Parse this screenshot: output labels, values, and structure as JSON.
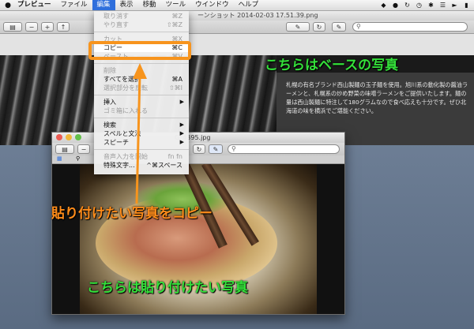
{
  "menubar": {
    "apple": "",
    "items": [
      {
        "label": "プレビュー",
        "bold": true
      },
      {
        "label": "ファイル",
        "bold": false
      },
      {
        "label": "編集",
        "bold": false
      },
      {
        "label": "表示",
        "bold": false
      },
      {
        "label": "移動",
        "bold": false
      },
      {
        "label": "ツール",
        "bold": false
      },
      {
        "label": "ウインドウ",
        "bold": false
      },
      {
        "label": "ヘルプ",
        "bold": false
      }
    ],
    "active_item": "編集"
  },
  "back_window": {
    "title": "ーンショット 2014-02-03 17.51.39.png",
    "panel_text": "札幌の有名ブランド西山製麺の玉子麺を使用。旭川系の動化製の醤油ラーメンと、札幌系の炒め野菜の味噌ラーメンをご提供いたします。麺の量は西山製麺に特注して180グラムなので食べ応えも十分です。ぜひ北海道の味を横浜でご堪能ください。"
  },
  "front_window": {
    "title": "G_4395.jpg"
  },
  "edit_menu": {
    "items": [
      {
        "label": "取り消す",
        "shortcut": "⌘Z",
        "disabled": true
      },
      {
        "label": "やり直す",
        "shortcut": "⇧⌘Z",
        "disabled": true
      },
      {
        "sep": true
      },
      {
        "label": "カット",
        "shortcut": "⌘X",
        "disabled": true
      },
      {
        "label": "コピー",
        "shortcut": "⌘C",
        "disabled": false,
        "highlight": true
      },
      {
        "label": "ペースト",
        "shortcut": "⌘V",
        "disabled": true
      },
      {
        "sep": true
      },
      {
        "label": "削除",
        "shortcut": "",
        "disabled": true
      },
      {
        "label": "すべてを選択",
        "shortcut": "⌘A",
        "disabled": false
      },
      {
        "label": "選択部分を反転",
        "shortcut": "⇧⌘I",
        "disabled": true
      },
      {
        "sep": true
      },
      {
        "label": "挿入",
        "shortcut": "",
        "disabled": false,
        "submenu": true
      },
      {
        "label": "ゴミ箱に入れる",
        "shortcut": "",
        "disabled": true
      },
      {
        "sep": true
      },
      {
        "label": "検索",
        "shortcut": "",
        "disabled": false,
        "submenu": true
      },
      {
        "label": "スペルと文法",
        "shortcut": "",
        "disabled": false,
        "submenu": true
      },
      {
        "label": "スピーチ",
        "shortcut": "",
        "disabled": false,
        "submenu": true
      },
      {
        "sep": true
      },
      {
        "label": "音声入力を開始",
        "shortcut": "fn fn",
        "disabled": true
      },
      {
        "label": "特殊文字...",
        "shortcut": "^⌘スペース",
        "disabled": false
      }
    ]
  },
  "annotations": {
    "base": "こちらはベースの写真",
    "copy": "貼り付けたい写真をコピー",
    "paste": "こちらは貼り付けたい写真"
  },
  "colors": {
    "highlight_orange": "#f7941d",
    "label_green": "#34e03a",
    "menu_active_blue": "#2f6fdc"
  }
}
